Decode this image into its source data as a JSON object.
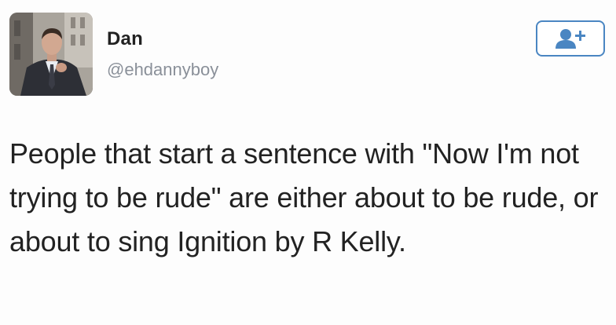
{
  "user": {
    "name": "Dan",
    "handle": "@ehdannyboy",
    "avatar_icon": "profile-photo"
  },
  "follow_button": {
    "icon": "add-user-icon",
    "color": "#4a86c2"
  },
  "tweet": {
    "text": "People that start a sentence with \"Now I'm not trying to be rude\" are either about to be rude, or about to sing Ignition by R Kelly."
  }
}
